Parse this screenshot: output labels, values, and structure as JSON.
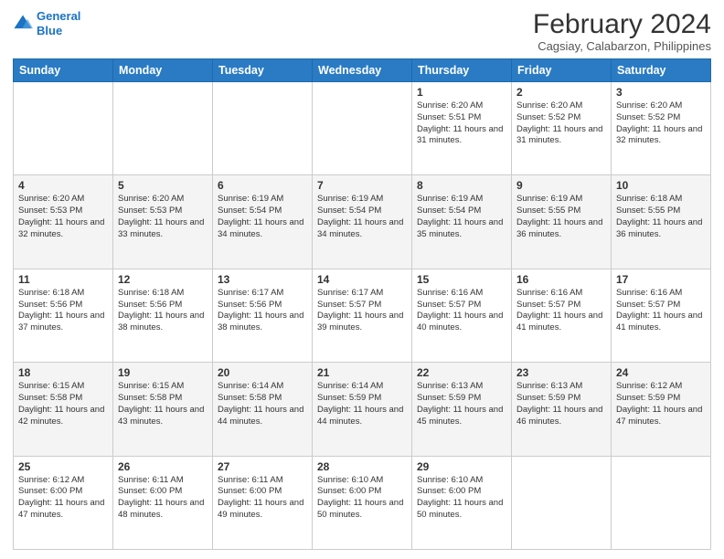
{
  "header": {
    "logo_line1": "General",
    "logo_line2": "Blue",
    "main_title": "February 2024",
    "subtitle": "Cagsiay, Calabarzon, Philippines"
  },
  "days_of_week": [
    "Sunday",
    "Monday",
    "Tuesday",
    "Wednesday",
    "Thursday",
    "Friday",
    "Saturday"
  ],
  "weeks": [
    [
      {
        "day": "",
        "info": ""
      },
      {
        "day": "",
        "info": ""
      },
      {
        "day": "",
        "info": ""
      },
      {
        "day": "",
        "info": ""
      },
      {
        "day": "1",
        "info": "Sunrise: 6:20 AM\nSunset: 5:51 PM\nDaylight: 11 hours and 31 minutes."
      },
      {
        "day": "2",
        "info": "Sunrise: 6:20 AM\nSunset: 5:52 PM\nDaylight: 11 hours and 31 minutes."
      },
      {
        "day": "3",
        "info": "Sunrise: 6:20 AM\nSunset: 5:52 PM\nDaylight: 11 hours and 32 minutes."
      }
    ],
    [
      {
        "day": "4",
        "info": "Sunrise: 6:20 AM\nSunset: 5:53 PM\nDaylight: 11 hours and 32 minutes."
      },
      {
        "day": "5",
        "info": "Sunrise: 6:20 AM\nSunset: 5:53 PM\nDaylight: 11 hours and 33 minutes."
      },
      {
        "day": "6",
        "info": "Sunrise: 6:19 AM\nSunset: 5:54 PM\nDaylight: 11 hours and 34 minutes."
      },
      {
        "day": "7",
        "info": "Sunrise: 6:19 AM\nSunset: 5:54 PM\nDaylight: 11 hours and 34 minutes."
      },
      {
        "day": "8",
        "info": "Sunrise: 6:19 AM\nSunset: 5:54 PM\nDaylight: 11 hours and 35 minutes."
      },
      {
        "day": "9",
        "info": "Sunrise: 6:19 AM\nSunset: 5:55 PM\nDaylight: 11 hours and 36 minutes."
      },
      {
        "day": "10",
        "info": "Sunrise: 6:18 AM\nSunset: 5:55 PM\nDaylight: 11 hours and 36 minutes."
      }
    ],
    [
      {
        "day": "11",
        "info": "Sunrise: 6:18 AM\nSunset: 5:56 PM\nDaylight: 11 hours and 37 minutes."
      },
      {
        "day": "12",
        "info": "Sunrise: 6:18 AM\nSunset: 5:56 PM\nDaylight: 11 hours and 38 minutes."
      },
      {
        "day": "13",
        "info": "Sunrise: 6:17 AM\nSunset: 5:56 PM\nDaylight: 11 hours and 38 minutes."
      },
      {
        "day": "14",
        "info": "Sunrise: 6:17 AM\nSunset: 5:57 PM\nDaylight: 11 hours and 39 minutes."
      },
      {
        "day": "15",
        "info": "Sunrise: 6:16 AM\nSunset: 5:57 PM\nDaylight: 11 hours and 40 minutes."
      },
      {
        "day": "16",
        "info": "Sunrise: 6:16 AM\nSunset: 5:57 PM\nDaylight: 11 hours and 41 minutes."
      },
      {
        "day": "17",
        "info": "Sunrise: 6:16 AM\nSunset: 5:57 PM\nDaylight: 11 hours and 41 minutes."
      }
    ],
    [
      {
        "day": "18",
        "info": "Sunrise: 6:15 AM\nSunset: 5:58 PM\nDaylight: 11 hours and 42 minutes."
      },
      {
        "day": "19",
        "info": "Sunrise: 6:15 AM\nSunset: 5:58 PM\nDaylight: 11 hours and 43 minutes."
      },
      {
        "day": "20",
        "info": "Sunrise: 6:14 AM\nSunset: 5:58 PM\nDaylight: 11 hours and 44 minutes."
      },
      {
        "day": "21",
        "info": "Sunrise: 6:14 AM\nSunset: 5:59 PM\nDaylight: 11 hours and 44 minutes."
      },
      {
        "day": "22",
        "info": "Sunrise: 6:13 AM\nSunset: 5:59 PM\nDaylight: 11 hours and 45 minutes."
      },
      {
        "day": "23",
        "info": "Sunrise: 6:13 AM\nSunset: 5:59 PM\nDaylight: 11 hours and 46 minutes."
      },
      {
        "day": "24",
        "info": "Sunrise: 6:12 AM\nSunset: 5:59 PM\nDaylight: 11 hours and 47 minutes."
      }
    ],
    [
      {
        "day": "25",
        "info": "Sunrise: 6:12 AM\nSunset: 6:00 PM\nDaylight: 11 hours and 47 minutes."
      },
      {
        "day": "26",
        "info": "Sunrise: 6:11 AM\nSunset: 6:00 PM\nDaylight: 11 hours and 48 minutes."
      },
      {
        "day": "27",
        "info": "Sunrise: 6:11 AM\nSunset: 6:00 PM\nDaylight: 11 hours and 49 minutes."
      },
      {
        "day": "28",
        "info": "Sunrise: 6:10 AM\nSunset: 6:00 PM\nDaylight: 11 hours and 50 minutes."
      },
      {
        "day": "29",
        "info": "Sunrise: 6:10 AM\nSunset: 6:00 PM\nDaylight: 11 hours and 50 minutes."
      },
      {
        "day": "",
        "info": ""
      },
      {
        "day": "",
        "info": ""
      }
    ]
  ]
}
